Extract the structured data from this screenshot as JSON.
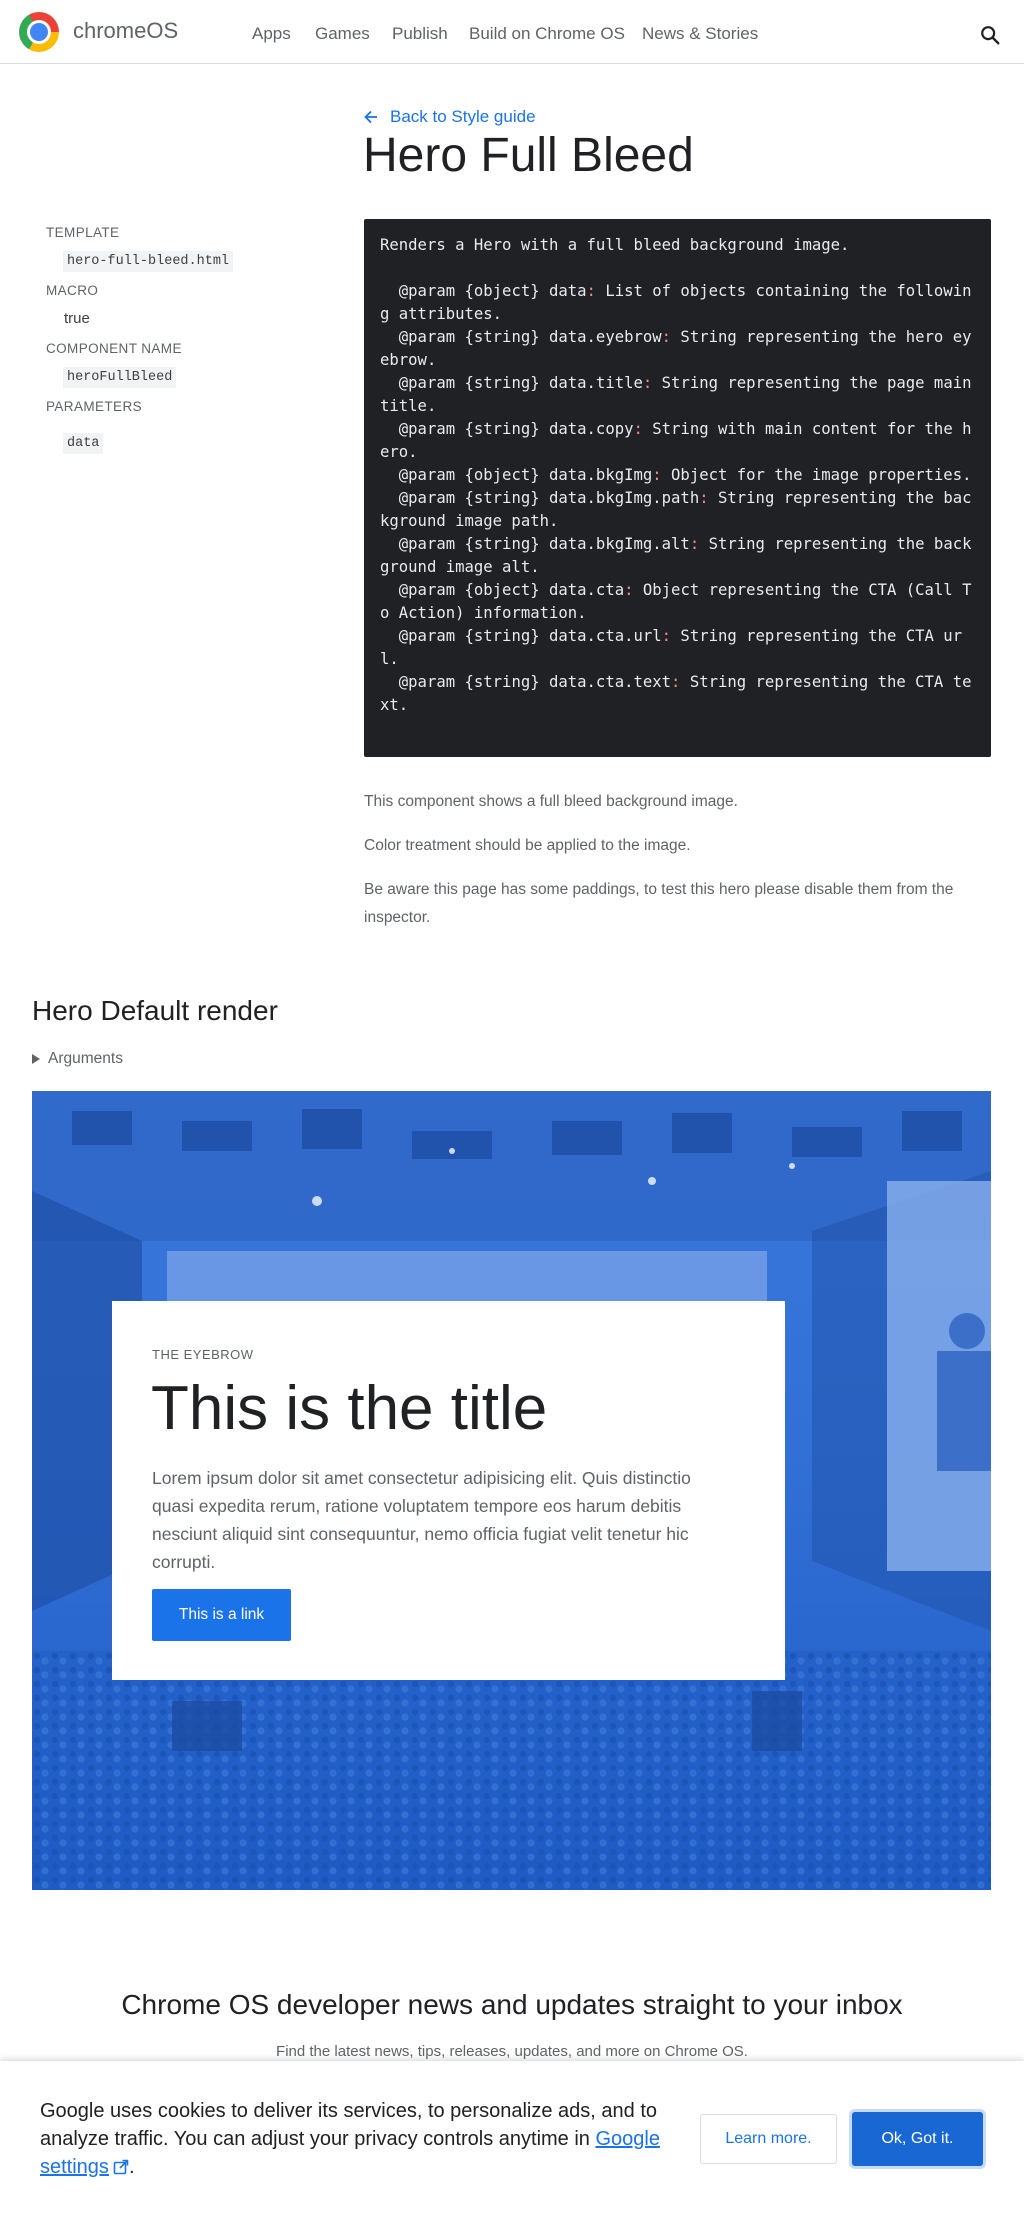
{
  "header": {
    "brand": "chromeOS",
    "nav": [
      "Apps",
      "Games",
      "Publish",
      "Build on Chrome OS",
      "News & Stories"
    ]
  },
  "sidebar": {
    "template_label": "TEMPLATE",
    "template_value": "hero-full-bleed.html",
    "macro_label": "MACRO",
    "macro_value": "true",
    "component_label": "COMPONENT NAME",
    "component_value": "heroFullBleed",
    "parameters_label": "PARAMETERS",
    "parameters_value": "data"
  },
  "main": {
    "back_link": "Back to Style guide",
    "title": "Hero Full Bleed",
    "code_intro": "Renders a Hero with a full bleed background image.",
    "params": [
      {
        "pre": "  @param {object} data",
        "post": " List of objects containing the following attributes."
      },
      {
        "pre": "  @param {string} data.eyebrow",
        "post": " String representing the hero eyebrow."
      },
      {
        "pre": "  @param {string} data.title",
        "post": " String representing the page main title."
      },
      {
        "pre": "  @param {string} data.copy",
        "post": " String with main content for the hero."
      },
      {
        "pre": "  @param {object} data.bkgImg",
        "post": " Object for the image properties."
      },
      {
        "pre": "  @param {string} data.bkgImg.path",
        "post": " String representing the background image path."
      },
      {
        "pre": "  @param {string} data.bkgImg.alt",
        "post": " String representing the background image alt."
      },
      {
        "pre": "  @param {object} data.cta",
        "post": " Object representing the CTA (Call To Action) information."
      },
      {
        "pre": "  @param {string} data.cta.url",
        "post": " String representing the CTA url."
      },
      {
        "pre": "  @param {string} data.cta.text",
        "post": " String representing the CTA text."
      }
    ],
    "desc1": "This component shows a full bleed background image.",
    "desc2": "Color treatment should be applied to the image.",
    "desc3": "Be aware this page has some paddings, to test this hero please disable them from the inspector."
  },
  "render": {
    "heading": "Hero Default render",
    "arguments": "Arguments"
  },
  "hero": {
    "eyebrow": "THE EYEBROW",
    "title": "This is the title",
    "copy": "Lorem ipsum dolor sit amet consectetur adipisicing elit. Quis distinctio quasi expedita rerum, ratione voluptatem tempore eos harum debitis nesciunt aliquid sint consequuntur, nemo officia fugiat velit tenetur hic corrupti.",
    "cta": "This is a link",
    "overlay_color": "#2f6fd8"
  },
  "newsletter": {
    "title": "Chrome OS developer news and updates straight to your inbox",
    "subtitle": "Find the latest news, tips, releases, updates, and more on Chrome OS."
  },
  "cookie": {
    "text": "Google uses cookies to deliver its services, to personalize ads, and to analyze traffic. You can adjust your privacy controls anytime in",
    "link": "Google settings",
    "end": ".",
    "learn": "Learn more.",
    "ok": "Ok, Got it."
  },
  "colors": {
    "accent": "#1a73e8",
    "code_bg": "#202124",
    "code_colon": "#f28b82"
  }
}
